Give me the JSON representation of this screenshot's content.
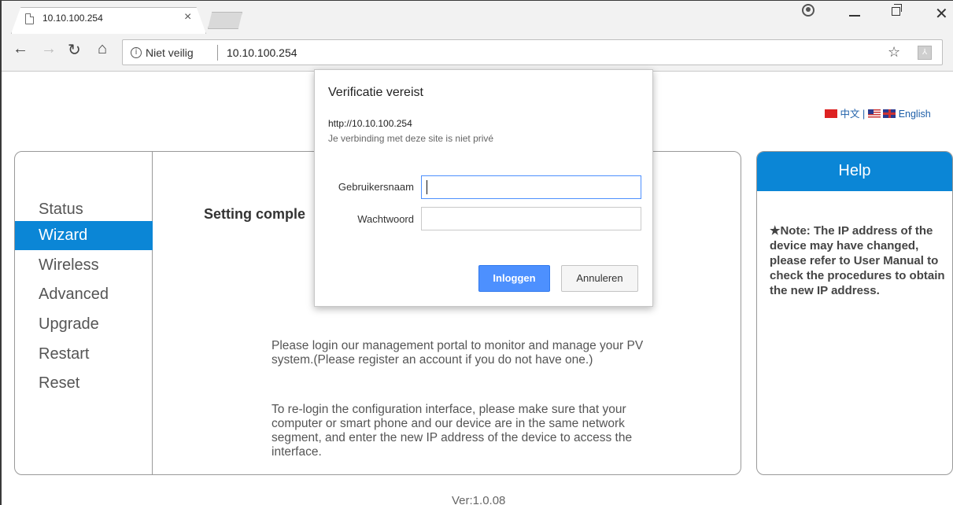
{
  "browser": {
    "tab_title": "10.10.100.254",
    "tab_close": "×",
    "security_label": "Niet veilig",
    "url": "10.10.100.254",
    "icons": [
      "page-icon",
      "profile-icon",
      "minimize-icon",
      "restore-icon",
      "close-icon",
      "back-icon",
      "forward-icon",
      "reload-icon",
      "home-icon",
      "info-icon",
      "star-icon",
      "pdf-icon"
    ]
  },
  "lang": {
    "chinese": "中文",
    "separator": "|",
    "english": "English"
  },
  "sidebar": {
    "items": [
      {
        "label": "Status"
      },
      {
        "label": "Wizard",
        "active": true
      },
      {
        "label": "Wireless"
      },
      {
        "label": "Advanced"
      },
      {
        "label": "Upgrade"
      },
      {
        "label": "Restart"
      },
      {
        "label": "Reset"
      }
    ]
  },
  "main": {
    "setting_title": "Setting comple",
    "message1": "Please login our management portal to monitor and manage your PV system.(Please register an account if you do not have one.)",
    "message2": "To re-login the configuration interface, please make sure that your computer or smart phone and our device are in the same network segment, and enter the new IP address of the device to access the interface."
  },
  "help": {
    "title": "Help",
    "text": "★Note: The IP address of the device may have changed, please refer to User Manual to check the procedures to obtain the new IP address."
  },
  "footer": {
    "version": "Ver:1.0.08"
  },
  "dialog": {
    "title": "Verificatie vereist",
    "url": "http://10.10.100.254",
    "warning": "Je verbinding met deze site is niet privé",
    "username_label": "Gebruikersnaam",
    "username_value": "",
    "password_label": "Wachtwoord",
    "password_value": "",
    "login_label": "Inloggen",
    "cancel_label": "Annuleren"
  },
  "colors": {
    "accent": "#0b86d6",
    "button_primary": "#4d90fe"
  }
}
